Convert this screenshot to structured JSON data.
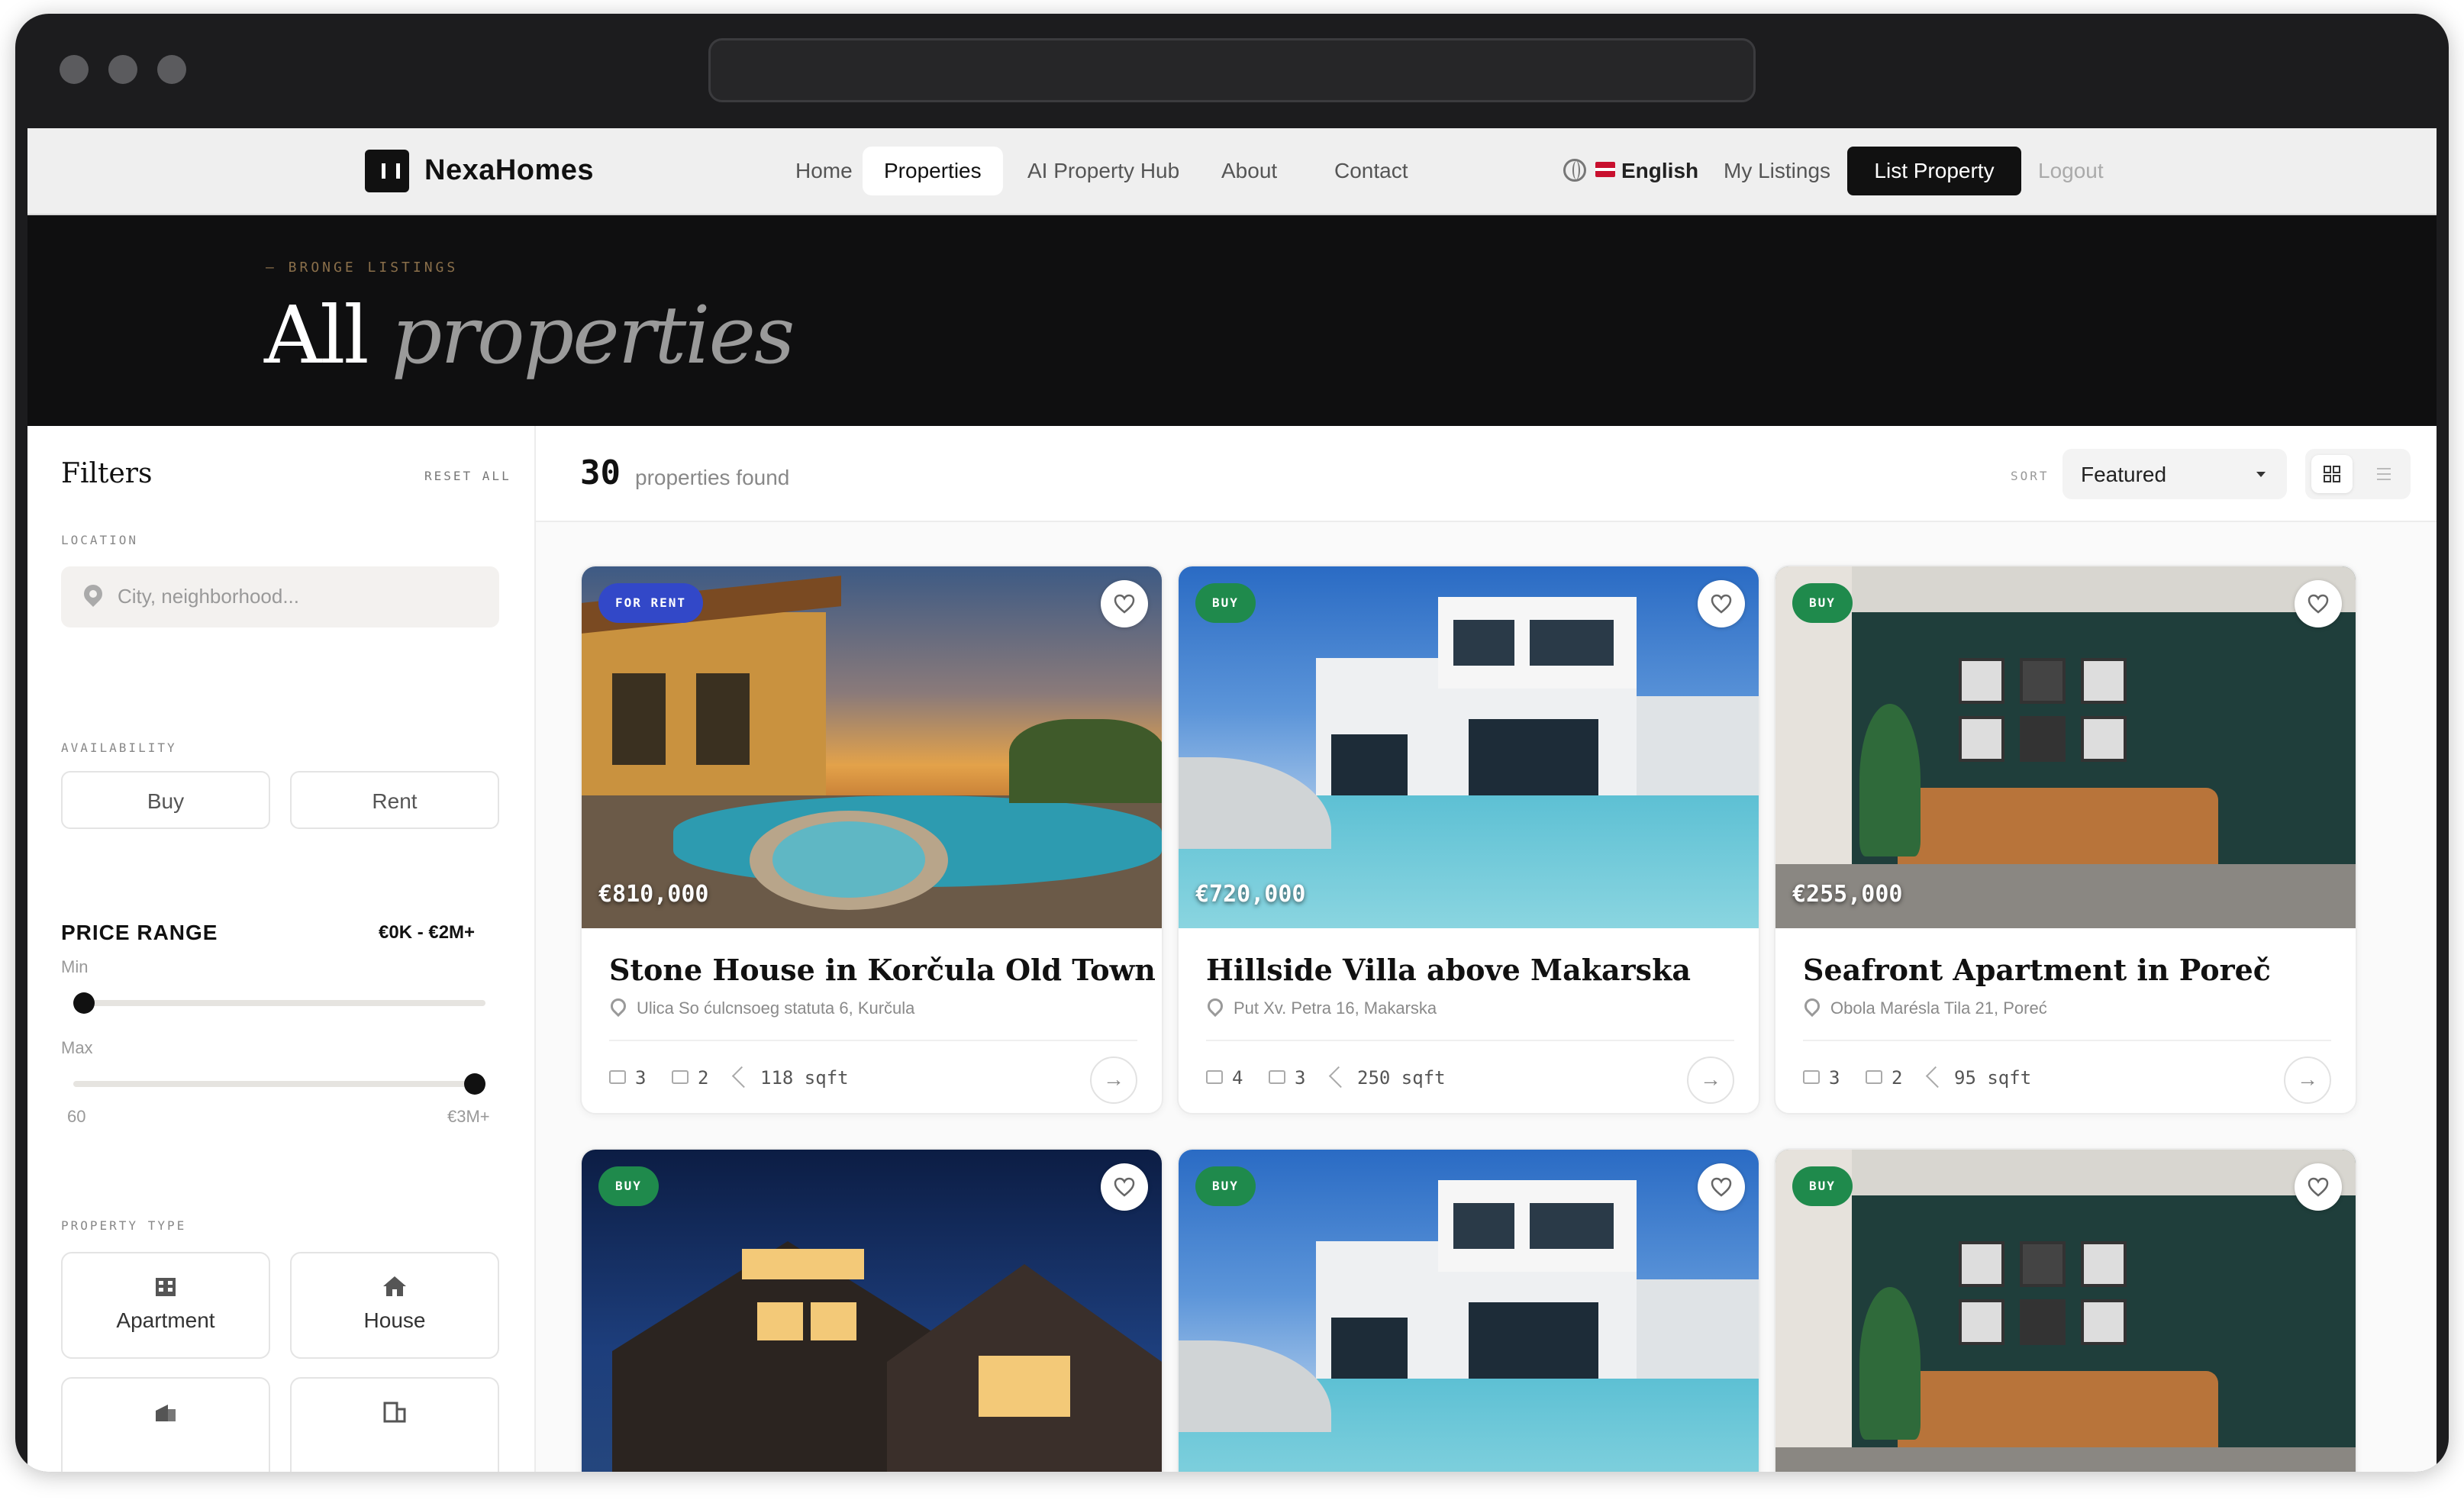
{
  "nav": {
    "brand": "NexaHomes",
    "links": [
      "Home",
      "Properties",
      "AI Property Hub",
      "About",
      "Contact"
    ],
    "active": "Properties",
    "language": "English",
    "my_listings": "My Listings",
    "list_property": "List Property",
    "logout": "Logout"
  },
  "hero": {
    "eyebrow": "— BRONGE LISTINGS",
    "title_plain": "All",
    "title_italic": "properties"
  },
  "filters": {
    "title": "Filters",
    "reset": "RESET ALL",
    "location_label": "LOCATION",
    "location_placeholder": "City, neighborhood...",
    "availability_label": "AVAILABILITY",
    "availability_options": [
      "Buy",
      "Rent"
    ],
    "price_range_label": "PRICE RANGE",
    "price_range_value": "€0K - €2M+",
    "min_label": "Min",
    "max_label": "Max",
    "slider_min_text": "60",
    "slider_max_text": "€3M+",
    "min_fraction": 0.0,
    "max_fraction": 1.0,
    "property_type_label": "PROPERTY TYPE",
    "property_types": [
      "Apartment",
      "House"
    ]
  },
  "results": {
    "count": "30",
    "count_label": "properties found",
    "sort_label": "SORT",
    "sort_value": "Featured"
  },
  "colors": {
    "rent_badge": "#3248c8",
    "buy_badge": "#1f8a4c",
    "brand_dark": "#111111"
  },
  "cards": [
    {
      "badge": "FOR RENT",
      "badge_type": "rent",
      "price": "€810,000",
      "title": "Stone House in Korčula Old Town",
      "address": "Ulica So ćulcnsoeg statuta 6, Kurčula",
      "beds": "3",
      "baths": "2",
      "area": "118 sqft",
      "scene": "sunset-villa"
    },
    {
      "badge": "BUY",
      "badge_type": "buy",
      "price": "€720,000",
      "title": "Hillside Villa above Makarska",
      "address": "Put Xv. Petra 16, Makarska",
      "beds": "4",
      "baths": "3",
      "area": "250 sqft",
      "scene": "white-villa"
    },
    {
      "badge": "BUY",
      "badge_type": "buy",
      "price": "€255,000",
      "title": "Seafront Apartment in Poreč",
      "address": "Obola Marésla Tila 21, Poreć",
      "beds": "3",
      "baths": "2",
      "area": "95 sqft",
      "scene": "interior"
    },
    {
      "badge": "BUY",
      "badge_type": "buy",
      "scene": "night-house"
    },
    {
      "badge": "BUY",
      "badge_type": "buy",
      "scene": "white-villa"
    },
    {
      "badge": "BUY",
      "badge_type": "buy",
      "scene": "interior"
    }
  ]
}
